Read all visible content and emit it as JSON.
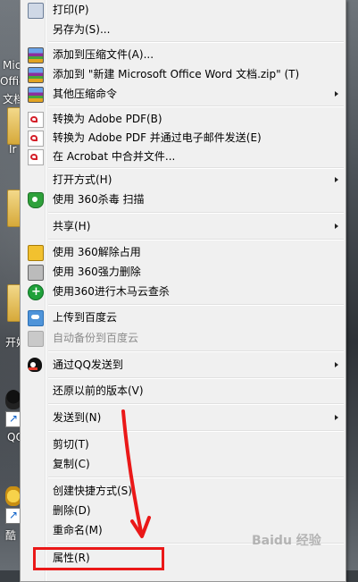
{
  "desktop": {
    "icon_labels": [
      "Mic",
      "Offic",
      "文档",
      "Ir",
      "开始",
      "QQ",
      "酷"
    ]
  },
  "menu": {
    "items": [
      {
        "label": "打印(P)",
        "icon": "printer-icon",
        "submenu": false,
        "disabled": false
      },
      {
        "label": "另存为(S)...",
        "icon": "",
        "submenu": false,
        "disabled": false
      },
      {
        "label": "添加到压缩文件(A)...",
        "icon": "archive-icon",
        "submenu": false,
        "disabled": false
      },
      {
        "label": "添加到 \"新建 Microsoft Office Word 文档.zip\" (T)",
        "icon": "archive-icon",
        "submenu": false,
        "disabled": false
      },
      {
        "label": "其他压缩命令",
        "icon": "archive-icon",
        "submenu": true,
        "disabled": false
      },
      {
        "label": "转换为 Adobe PDF(B)",
        "icon": "pdf-icon",
        "submenu": false,
        "disabled": false
      },
      {
        "label": "转换为 Adobe PDF 并通过电子邮件发送(E)",
        "icon": "pdf-email-icon",
        "submenu": false,
        "disabled": false
      },
      {
        "label": "在 Acrobat 中合并文件...",
        "icon": "pdf-merge-icon",
        "submenu": false,
        "disabled": false
      },
      {
        "label": "打开方式(H)",
        "icon": "",
        "submenu": true,
        "disabled": false
      },
      {
        "label": "使用 360杀毒 扫描",
        "icon": "shield-icon",
        "submenu": false,
        "disabled": false
      },
      {
        "label": "共享(H)",
        "icon": "",
        "submenu": true,
        "disabled": false
      },
      {
        "label": "使用 360解除占用",
        "icon": "unlock-icon",
        "submenu": false,
        "disabled": false
      },
      {
        "label": "使用 360强力删除",
        "icon": "shredder-icon",
        "submenu": false,
        "disabled": false
      },
      {
        "label": "使用360进行木马云查杀",
        "icon": "trojan-scan-icon",
        "submenu": false,
        "disabled": false
      },
      {
        "label": "上传到百度云",
        "icon": "cloud-upload-icon",
        "submenu": false,
        "disabled": false
      },
      {
        "label": "自动备份到百度云",
        "icon": "cloud-backup-icon",
        "submenu": false,
        "disabled": true
      },
      {
        "label": "通过QQ发送到",
        "icon": "qq-penguin-icon",
        "submenu": true,
        "disabled": false
      },
      {
        "label": "还原以前的版本(V)",
        "icon": "",
        "submenu": false,
        "disabled": false
      },
      {
        "label": "发送到(N)",
        "icon": "",
        "submenu": true,
        "disabled": false
      },
      {
        "label": "剪切(T)",
        "icon": "",
        "submenu": false,
        "disabled": false
      },
      {
        "label": "复制(C)",
        "icon": "",
        "submenu": false,
        "disabled": false
      },
      {
        "label": "创建快捷方式(S)",
        "icon": "",
        "submenu": false,
        "disabled": false
      },
      {
        "label": "删除(D)",
        "icon": "",
        "submenu": false,
        "disabled": false
      },
      {
        "label": "重命名(M)",
        "icon": "",
        "submenu": false,
        "disabled": false
      },
      {
        "label": "属性(R)",
        "icon": "",
        "submenu": false,
        "disabled": false
      }
    ]
  },
  "annotation": {
    "highlight_color": "#ea1818",
    "highlighted_item": "属性(R)"
  },
  "watermark": "Baidu 经验"
}
